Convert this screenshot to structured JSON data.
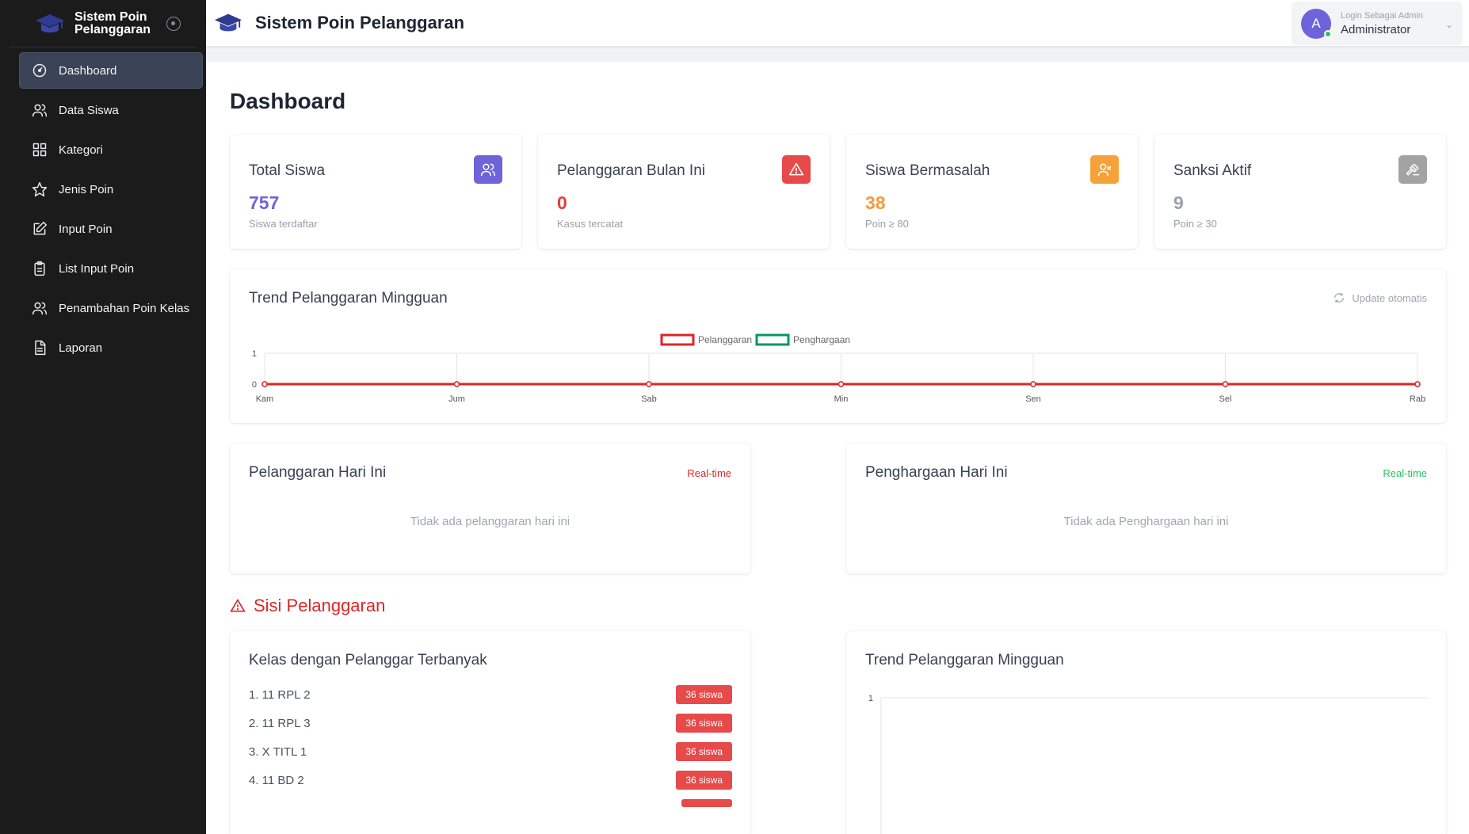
{
  "app": {
    "brand": "Sistem Poin Pelanggaran",
    "title": "Sistem Poin Pelanggaran"
  },
  "sidebar": {
    "items": [
      {
        "label": "Dashboard",
        "icon": "gauge-icon",
        "active": true
      },
      {
        "label": "Data Siswa",
        "icon": "users-icon"
      },
      {
        "label": "Kategori",
        "icon": "grid-icon"
      },
      {
        "label": "Jenis Poin",
        "icon": "star-icon"
      },
      {
        "label": "Input Poin",
        "icon": "edit-icon"
      },
      {
        "label": "List Input Poin",
        "icon": "clipboard-icon"
      },
      {
        "label": "Penambahan Poin Kelas",
        "icon": "users-icon"
      },
      {
        "label": "Laporan",
        "icon": "document-icon"
      }
    ]
  },
  "user": {
    "initial": "A",
    "subtitle": "Login Sebagai Admin",
    "name": "Administrator"
  },
  "page": {
    "title": "Dashboard"
  },
  "stats": [
    {
      "title": "Total Siswa",
      "value": "757",
      "sub": "Siswa terdaftar",
      "color": "#6f63d9",
      "icon_bg": "#6f63d9",
      "icon": "users-icon"
    },
    {
      "title": "Pelanggaran Bulan Ini",
      "value": "0",
      "sub": "Kasus tercatat",
      "color": "#e53e3e",
      "icon_bg": "#e74a4a",
      "icon": "warning-icon"
    },
    {
      "title": "Siswa Bermasalah",
      "value": "38",
      "sub": "Poin ≥ 80",
      "color": "#f6993f",
      "icon_bg": "#f6a23a",
      "icon": "user-x-icon"
    },
    {
      "title": "Sanksi Aktif",
      "value": "9",
      "sub": "Poin ≥ 30",
      "color": "#9aa0ab",
      "icon_bg": "#a3a3a3",
      "icon": "gavel-icon"
    }
  ],
  "trend": {
    "title": "Trend Pelanggaran Mingguan",
    "update_label": "Update otomatis"
  },
  "chart_data": [
    {
      "type": "line",
      "categories": [
        "Kam",
        "Jum",
        "Sab",
        "Min",
        "Sen",
        "Sel",
        "Rab"
      ],
      "series": [
        {
          "name": "Pelanggaran",
          "values": [
            0,
            0,
            0,
            0,
            0,
            0,
            0
          ],
          "color": "#dc2626"
        },
        {
          "name": "Penghargaan",
          "values": [
            0,
            0,
            0,
            0,
            0,
            0,
            0
          ],
          "color": "#059669"
        }
      ],
      "ylim": [
        0,
        1
      ],
      "yticks": [
        "0",
        "1"
      ],
      "legend": "top-center",
      "grid": true
    },
    {
      "type": "line",
      "categories": [],
      "series": [],
      "ylim": [
        0,
        1
      ],
      "yticks": [
        "1"
      ],
      "grid": true
    }
  ],
  "today": {
    "violations": {
      "title": "Pelanggaran Hari Ini",
      "badge": "Real-time",
      "empty": "Tidak ada pelanggaran hari ini",
      "color": "#dc2626"
    },
    "awards": {
      "title": "Penghargaan Hari Ini",
      "badge": "Real-time",
      "empty": "Tidak ada Penghargaan hari ini",
      "color": "#22c55e"
    }
  },
  "violation_section": {
    "title": "Sisi Pelanggaran",
    "top_classes": {
      "title": "Kelas dengan Pelanggar Terbanyak",
      "rows": [
        {
          "name": "1. 11 RPL 2",
          "count": "36 siswa"
        },
        {
          "name": "2. 11 RPL 3",
          "count": "36 siswa"
        },
        {
          "name": "3. X TITL 1",
          "count": "36 siswa"
        },
        {
          "name": "4. 11 BD 2",
          "count": "36 siswa"
        }
      ]
    },
    "trend_title": "Trend Pelanggaran Mingguan"
  }
}
